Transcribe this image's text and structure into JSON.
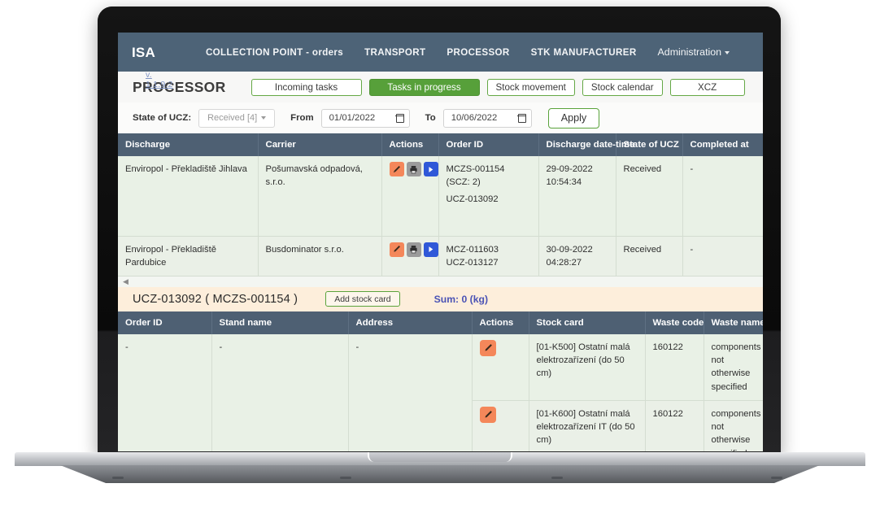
{
  "navbar": {
    "brand": "ISA",
    "version": "v. 1.1.9.2",
    "links": [
      {
        "label": "COLLECTION POINT - orders"
      },
      {
        "label": "TRANSPORT"
      },
      {
        "label": "PROCESSOR"
      },
      {
        "label": "STK MANUFACTURER"
      },
      {
        "label": "Administration"
      }
    ]
  },
  "toolbar": {
    "page_title": "PROCESSOR",
    "tabs": [
      {
        "label": "Incoming tasks",
        "active": false
      },
      {
        "label": "Tasks in progress",
        "active": true
      },
      {
        "label": "Stock movement",
        "active": false
      },
      {
        "label": "Stock calendar",
        "active": false
      },
      {
        "label": "XCZ",
        "active": false
      }
    ]
  },
  "filterbar": {
    "state_label": "State of UCZ:",
    "state_value": "Received [4]",
    "from_label": "From",
    "from_value": "01/01/2022",
    "to_label": "To",
    "to_value": "10/06/2022",
    "apply_label": "Apply"
  },
  "main_table": {
    "columns": [
      "Discharge",
      "Carrier",
      "Actions",
      "Order ID",
      "Discharge date-time",
      "State of UCZ",
      "Completed at"
    ],
    "rows": [
      {
        "discharge": "Enviropol - Překladiště Jihlava",
        "carrier": "Pošumavská odpadová, s.r.o.",
        "actions": [
          "edit-icon",
          "print-icon",
          "play-icon"
        ],
        "order_id_line1": "MCZS-001154  (SCZ: 2)",
        "order_id_line2": "UCZ-013092",
        "date": "29-09-2022",
        "time": "10:54:34",
        "state": "Received",
        "completed_at": "-"
      },
      {
        "discharge": "Enviropol - Překladiště Pardubice",
        "carrier": "Busdominator s.r.o.",
        "actions": [
          "edit-icon",
          "print-icon",
          "play-icon"
        ],
        "order_id_line1": "MCZ-011603",
        "order_id_line2": "UCZ-013127",
        "date": "30-09-2022",
        "time": "04:28:27",
        "state": "Received",
        "completed_at": "-"
      }
    ]
  },
  "detail": {
    "title": "UCZ-013092 ( MCZS-001154 )",
    "add_button": "Add stock card",
    "sum": "Sum: 0 (kg)",
    "columns": [
      "Order ID",
      "Stand name",
      "Address",
      "Actions",
      "Stock card",
      "Waste code",
      "Waste name"
    ],
    "order_id": "-",
    "stand_name": "-",
    "address": "-",
    "rows": [
      {
        "action": "edit-icon",
        "stock_card": "[01-K500] Ostatní malá elektrozařízení (do 50 cm)",
        "waste_code": "160122",
        "waste_name": "components not otherwise specified"
      },
      {
        "action": "edit-icon",
        "stock_card": "[01-K600] Ostatní malá elektrozařízení IT (do 50 cm)",
        "waste_code": "160122",
        "waste_name": "components not otherwise specified"
      }
    ]
  },
  "colors": {
    "navbar_bg": "#4d6377",
    "table_header_bg": "#4e6073",
    "accent_green": "#57a03a",
    "row_bg": "#e9f1e6",
    "detail_head_bg": "#fdeedb",
    "sum_text": "#4a52b5",
    "edit_icon": "#f4875a",
    "print_icon": "#9b9b9b",
    "play_icon": "#2f58d8"
  }
}
